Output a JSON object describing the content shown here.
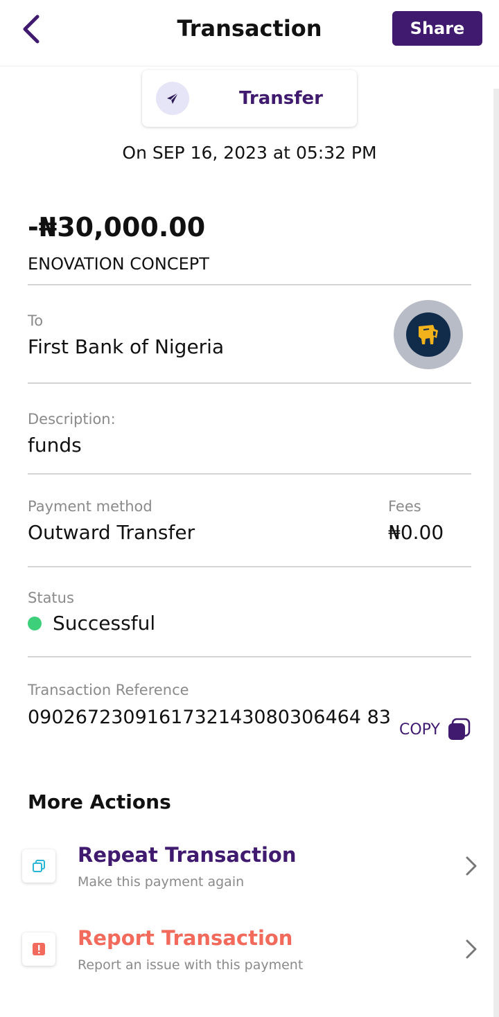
{
  "header": {
    "title": "Transaction",
    "share_label": "Share"
  },
  "type_card": {
    "label": "Transfer"
  },
  "datetime": {
    "on": "On",
    "date": "SEP 16, 2023",
    "at": "at",
    "time": "05:32 PM"
  },
  "amount": "-₦30,000.00",
  "beneficiary": "ENOVATION CONCEPT",
  "to": {
    "label": "To",
    "bank": "First Bank of Nigeria"
  },
  "description": {
    "label": "Description:",
    "value": "funds"
  },
  "payment_method": {
    "label": "Payment method",
    "value": "Outward Transfer"
  },
  "fees": {
    "label": "Fees",
    "value": "₦0.00"
  },
  "status": {
    "label": "Status",
    "value": "Successful",
    "color": "#3ecf7a"
  },
  "reference": {
    "label": "Transaction Reference",
    "value": "0902672309161732143080306464 83",
    "copy_label": "COPY"
  },
  "more_actions": {
    "title": "More Actions",
    "items": [
      {
        "title": "Repeat Transaction",
        "subtitle": "Make this payment again",
        "color": "#3f1a6e",
        "icon": "repeat-icon"
      },
      {
        "title": "Report Transaction",
        "subtitle": "Report an issue with this payment",
        "color": "#f26a5b",
        "icon": "alert-icon"
      }
    ]
  },
  "colors": {
    "brand": "#3f1a6e",
    "success": "#3ecf7a",
    "danger": "#f26a5b"
  }
}
